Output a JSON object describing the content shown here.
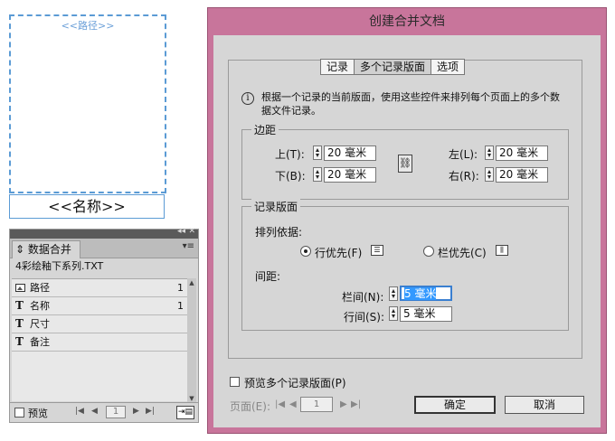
{
  "layout": {
    "frame_label": "<<路径>>",
    "name_label": "<<名称>>"
  },
  "panel": {
    "tab": "数据合并",
    "collapse_icon": "double-chevron-icon",
    "source": "4彩绘釉下系列.TXT",
    "fields": [
      {
        "icon": "image-icon",
        "name": "路径",
        "count": "1"
      },
      {
        "icon": "T",
        "name": "名称",
        "count": "1"
      },
      {
        "icon": "T",
        "name": "尺寸",
        "count": ""
      },
      {
        "icon": "T",
        "name": "备注",
        "count": ""
      }
    ],
    "preview_label": "预览",
    "page_value": "1"
  },
  "dialog": {
    "title": "创建合并文档",
    "tabs": [
      "记录",
      "多个记录版面",
      "选项"
    ],
    "active_tab": 1,
    "info": "根据一个记录的当前版面，使用这些控件来排列每个页面上的多个数据文件记录。",
    "margins": {
      "legend": "边距",
      "top_label": "上(T):",
      "top_value": "20 毫米",
      "bottom_label": "下(B):",
      "bottom_value": "20 毫米",
      "left_label": "左(L):",
      "left_value": "20 毫米",
      "right_label": "右(R):",
      "right_value": "20 毫米"
    },
    "layout_group": {
      "legend": "记录版面",
      "arrange_label": "排列依据:",
      "row_first": "行优先(F)",
      "col_first": "栏优先(C)",
      "selected": "row_first",
      "spacing_label": "间距:",
      "col_gap_label": "栏间(N):",
      "col_gap_value": "5 毫米",
      "row_gap_label": "行间(S):",
      "row_gap_value": "5 毫米"
    },
    "preview_label": "预览多个记录版面(P)",
    "page_label": "页面(E):",
    "page_value": "1",
    "ok": "确定",
    "cancel": "取消"
  },
  "colors": {
    "title_bar": "#c8759b",
    "frame_border": "#5b9bd5",
    "selection": "#3399ff"
  }
}
